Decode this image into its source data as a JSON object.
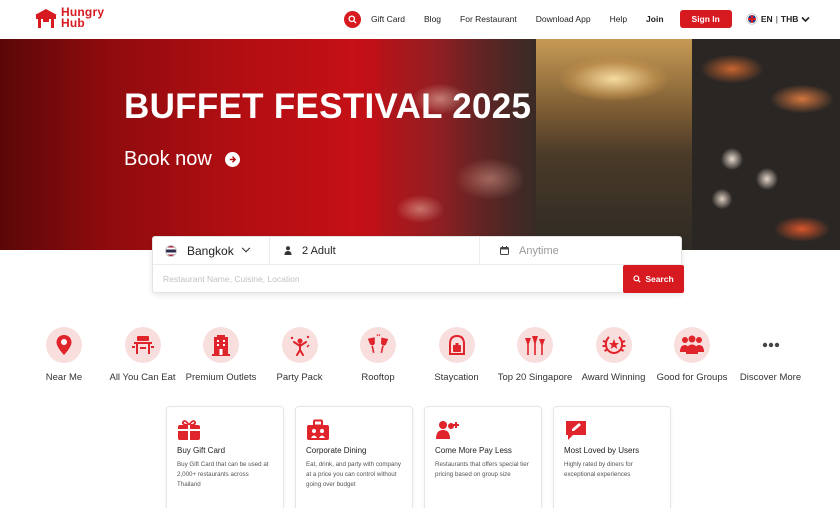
{
  "header": {
    "logo": {
      "line1": "Hungry",
      "line2": "Hub"
    },
    "nav": {
      "gift_card": "Gift Card",
      "blog": "Blog",
      "for_restaurant": "For Restaurant",
      "download_app": "Download App",
      "help": "Help",
      "join": "Join",
      "sign_in": "Sign In",
      "language": "EN",
      "currency": "THB"
    }
  },
  "hero": {
    "title": "BUFFET FESTIVAL 2025",
    "cta": "Book now"
  },
  "search": {
    "city": "Bangkok",
    "guests": "2 Adult",
    "date_placeholder": "Anytime",
    "query_placeholder": "Restaurant Name, Cuisine, Location",
    "button": "Search"
  },
  "categories": [
    {
      "label": "Near Me",
      "icon": "location-pin-icon"
    },
    {
      "label": "All You Can Eat",
      "icon": "dining-table-icon"
    },
    {
      "label": "Premium Outlets",
      "icon": "building-icon"
    },
    {
      "label": "Party Pack",
      "icon": "party-icon"
    },
    {
      "label": "Rooftop",
      "icon": "wine-glasses-icon"
    },
    {
      "label": "Staycation",
      "icon": "luggage-icon"
    },
    {
      "label": "Top 20 Singapore",
      "icon": "supertrees-icon"
    },
    {
      "label": "Award Winning",
      "icon": "laurel-award-icon"
    },
    {
      "label": "Good for Groups",
      "icon": "group-icon"
    },
    {
      "label": "Discover More",
      "icon": "more-dots-icon"
    }
  ],
  "cards": [
    {
      "title": "Buy Gift Card",
      "desc": "Buy Gift Card that can be used at 2,000+ restaurants across Thailand",
      "icon": "gift-card-icon"
    },
    {
      "title": "Corporate Dining",
      "desc": "Eat, drink, and party with company at a price you can control without going over budget",
      "icon": "briefcase-icon"
    },
    {
      "title": "Come More Pay Less",
      "desc": "Restaurants that offers special tier pricing based on group size",
      "icon": "add-people-icon"
    },
    {
      "title": "Most Loved by Users",
      "desc": "Highly rated by diners for exceptional experiences",
      "icon": "review-icon"
    }
  ],
  "colors": {
    "brand": "#d71920",
    "icon_bg": "#f9dede"
  }
}
